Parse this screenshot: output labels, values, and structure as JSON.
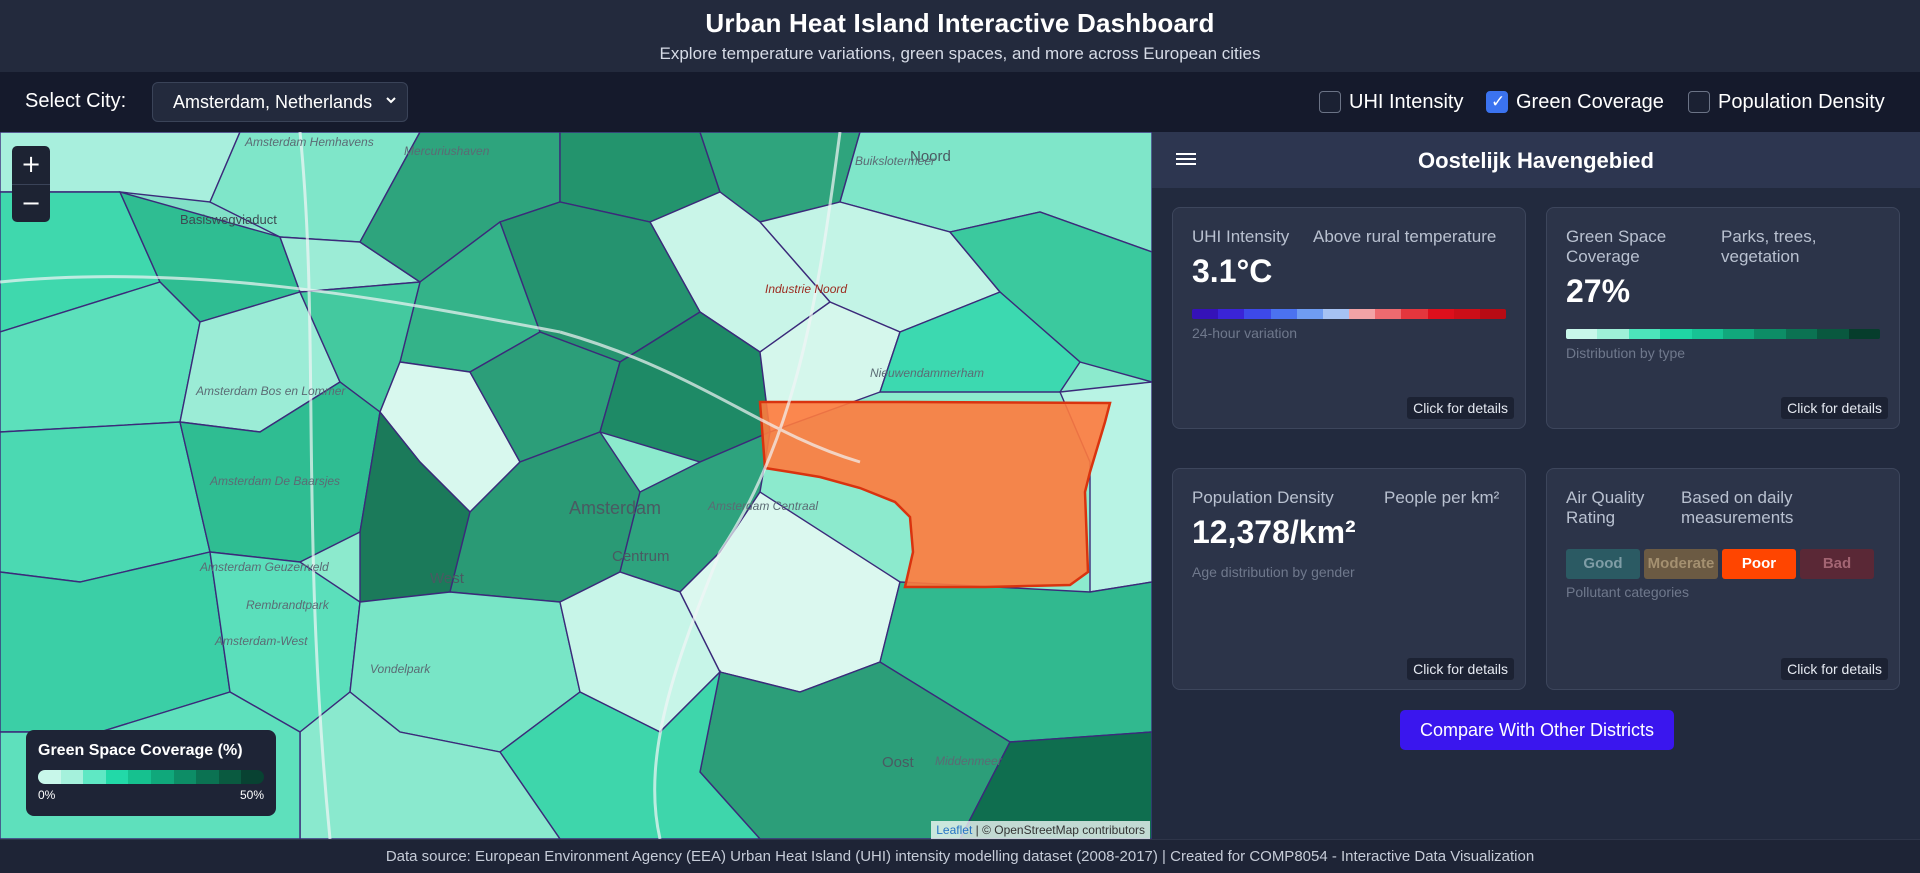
{
  "header": {
    "title": "Urban Heat Island Interactive Dashboard",
    "subtitle": "Explore temperature variations, green spaces, and more across European cities"
  },
  "controls": {
    "city_label": "Select City:",
    "city_selected": "Amsterdam, Netherlands",
    "toggles": [
      {
        "label": "UHI Intensity",
        "checked": false
      },
      {
        "label": "Green Coverage",
        "checked": true
      },
      {
        "label": "Population Density",
        "checked": false
      }
    ]
  },
  "map": {
    "zoom_in": "+",
    "zoom_out": "−",
    "legend": {
      "title": "Green Space Coverage (%)",
      "min_label": "0%",
      "max_label": "50%",
      "colors": [
        "#c8f7ea",
        "#a5f1dc",
        "#5fe8c4",
        "#22d9a8",
        "#16c18f",
        "#10a87b",
        "#0d8d66",
        "#0b7252",
        "#0a5a40",
        "#084232"
      ]
    },
    "attribution": {
      "leaflet": "Leaflet",
      "rest": "| © OpenStreetMap contributors"
    },
    "highlight_color": "#ff7a3d",
    "labels": {
      "noord": "Noord",
      "amsterdam": "Amsterdam",
      "centrum": "Centrum",
      "west": "West",
      "oost": "Oost",
      "basisweg": "Basisweg­viaduct",
      "hemhavens": "Amsterdam Hemhavens",
      "mercurius": "Mercuriushaven",
      "buikslotermeer": "Buikslotermeer",
      "nieuwendammerham": "Nieuwendammerham",
      "amsterdam_centraal": "Amsterdam Centraal",
      "bos_en_lommer": "Amsterdam Bos en Lommer",
      "de_baarsjes": "Amsterdam De Baarsjes",
      "geuzenveld": "Amsterdam Geuzenveld",
      "rembrandtpark": "Rembrandtpark",
      "amsterdam_west": "Amsterdam-West",
      "vondelpark": "Vondelpark",
      "middenmeer": "Middenmeer",
      "industrie_noord": "Industrie Noord"
    }
  },
  "panel": {
    "district": "Oostelijk Havengebied",
    "cards": {
      "uhi": {
        "label": "UHI Intensity",
        "sub": "Above rural temperature",
        "value": "3.1°C",
        "note": "24-hour variation",
        "button": "Click for details",
        "colors": [
          "#3512b8",
          "#3a24d6",
          "#3d49e8",
          "#4b72f0",
          "#6f9cf2",
          "#a6c2f3",
          "#f2a3a6",
          "#ee6a6f",
          "#e4363d",
          "#dd0f1c",
          "#cc0e18",
          "#b80b14"
        ]
      },
      "green": {
        "label": "Green Space Coverage",
        "sub": "Parks, trees, vegetation",
        "value": "27%",
        "note": "Distribution by type",
        "button": "Click for details",
        "colors": [
          "#c8f7ea",
          "#9ef0d8",
          "#4de4bb",
          "#1fd6a4",
          "#17c394",
          "#11a87c",
          "#0d8d66",
          "#0b7252",
          "#09583f",
          "#063d2c"
        ]
      },
      "population": {
        "label": "Population Density",
        "sub": "People per km²",
        "value": "12,378/km²",
        "note": "Age distribution by gender",
        "button": "Click for details"
      },
      "air": {
        "label": "Air Quality Rating",
        "sub": "Based on daily measurements",
        "ratings": [
          {
            "label": "Good",
            "bg": "#2b5a63",
            "fg": "#7f9da6"
          },
          {
            "label": "Moderate",
            "bg": "#6b5a43",
            "fg": "#a49070"
          },
          {
            "label": "Poor",
            "bg": "#ff4500",
            "fg": "#ffffff"
          },
          {
            "label": "Bad",
            "bg": "#5a2836",
            "fg": "#a36573"
          }
        ],
        "note": "Pollutant categories",
        "button": "Click for details"
      }
    },
    "compare_button": "Compare With Other Districts"
  },
  "footer": {
    "text": "Data source: European Environment Agency (EEA) Urban Heat Island (UHI) intensity modelling dataset (2008-2017) | Created for COMP8054 - Interactive Data Visualization"
  }
}
